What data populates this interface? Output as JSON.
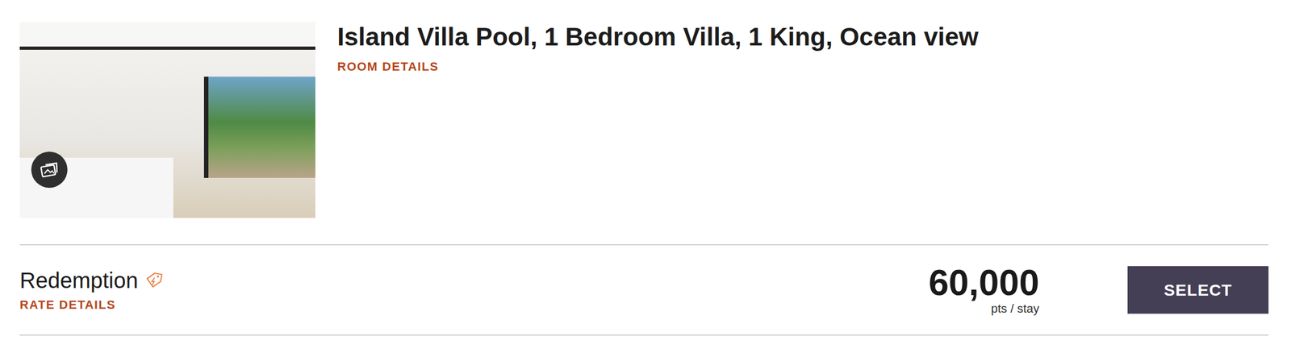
{
  "room": {
    "title": "Island Villa Pool, 1 Bedroom Villa, 1 King, Ocean view",
    "details_link": "ROOM DETAILS"
  },
  "rates": [
    {
      "name": "Redemption",
      "details_link": "RATE DETAILS",
      "price": "60,000",
      "unit": "pts / stay",
      "button": "SELECT"
    }
  ]
}
